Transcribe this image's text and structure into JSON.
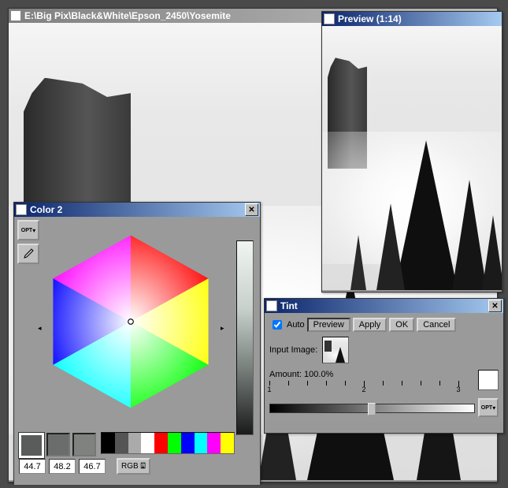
{
  "main_window": {
    "title": "E:\\Big Pix\\Black&White\\Epson_2450\\Yosemite"
  },
  "preview_window": {
    "title": "Preview (1:14)"
  },
  "color_window": {
    "title": "Color 2",
    "opt_label": "OPT",
    "values": {
      "v1": "44.7",
      "v2": "48.2",
      "v3": "46.7"
    },
    "mode": "RGB",
    "swatches": [
      "#595c5a",
      "#6a6d6b",
      "#7f827f"
    ],
    "palette": [
      "#000000",
      "#555555",
      "#aaaaaa",
      "#ffffff",
      "#ff0000",
      "#00ff00",
      "#0000ff",
      "#00ffff",
      "#ff00ff",
      "#ffff00"
    ]
  },
  "tint_window": {
    "title": "Tint",
    "auto_label": "Auto",
    "preview_label": "Preview",
    "apply_label": "Apply",
    "ok_label": "OK",
    "cancel_label": "Cancel",
    "input_image_label": "Input Image:",
    "amount_label": "Amount:",
    "amount_value": "100.0%",
    "ruler": {
      "min": "1",
      "mid": "2",
      "max": "3"
    },
    "opt_label": "OPT",
    "auto_checked": true,
    "output_color": "#ffffff"
  }
}
